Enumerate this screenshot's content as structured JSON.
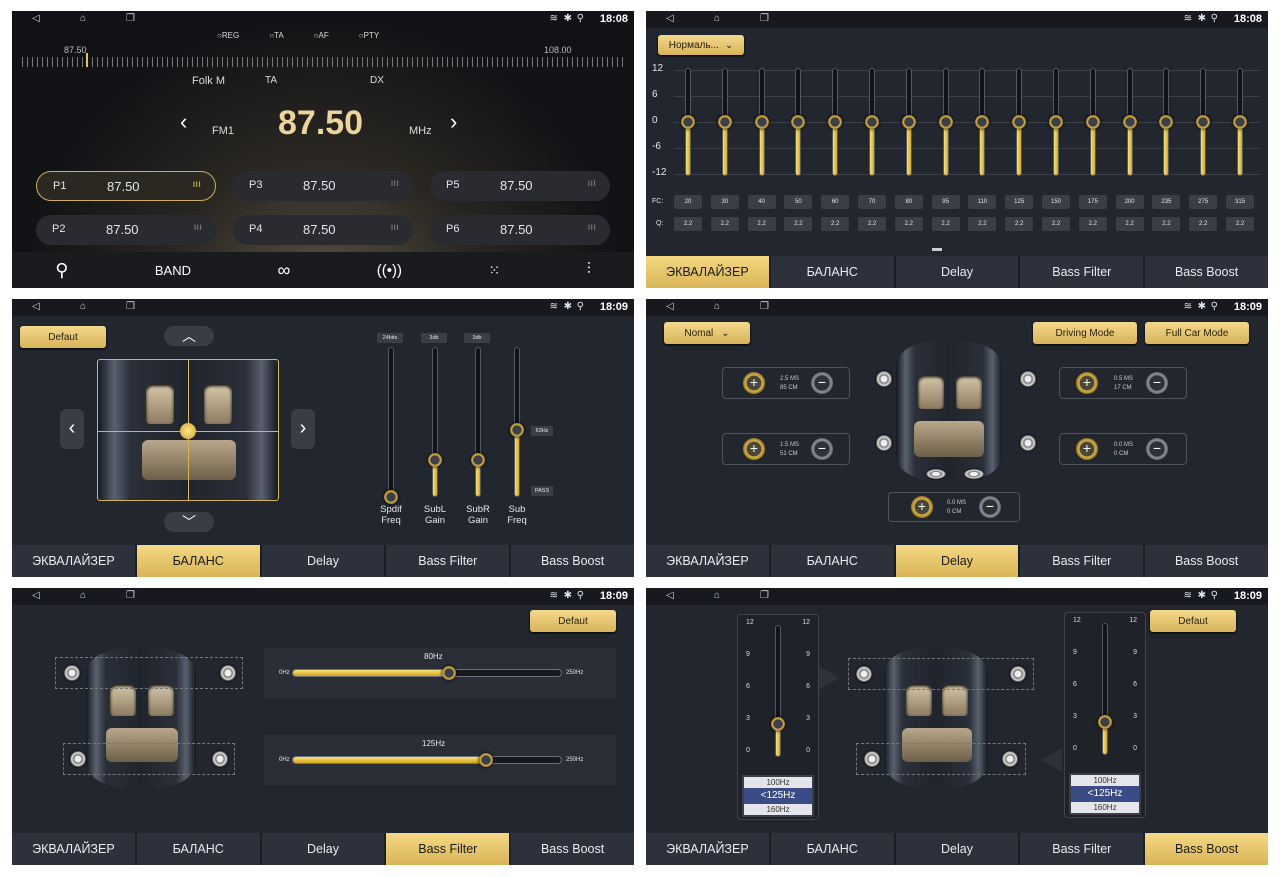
{
  "status": {
    "t1": "18:08",
    "t2": "18:08",
    "t3": "18:09",
    "t4": "18:09",
    "t5": "18:09",
    "t6": "18:09"
  },
  "nav_icons": {
    "back": "◁",
    "home": "⌂",
    "recent": "❐",
    "wifi": "wifi-icon",
    "bt": "bluetooth-icon",
    "gps": "location-icon"
  },
  "colors": {
    "accent": "#e5c25a",
    "bg": "#22262f",
    "tab": "#2c313b"
  },
  "tabs": [
    "ЭКВАЛАЙЗЕР",
    "БАЛАНС",
    "Delay",
    "Bass Filter",
    "Bass Boost"
  ],
  "radio": {
    "rds": [
      "REG",
      "TA",
      "AF",
      "PTY"
    ],
    "scale_min": "87.50",
    "scale_max": "108.00",
    "info": {
      "station": "Folk M",
      "ta": "TA",
      "dx": "DX"
    },
    "band": "FM1",
    "freq": "87.50",
    "unit": "MHz",
    "presets": [
      {
        "id": "P1",
        "freq": "87.50"
      },
      {
        "id": "P2",
        "freq": "87.50"
      },
      {
        "id": "P3",
        "freq": "87.50"
      },
      {
        "id": "P4",
        "freq": "87.50"
      },
      {
        "id": "P5",
        "freq": "87.50"
      },
      {
        "id": "P6",
        "freq": "87.50"
      }
    ],
    "bottom": {
      "band": "BAND"
    }
  },
  "eq": {
    "preset": "Нормаль...",
    "scale": [
      "12",
      "6",
      "0",
      "-6",
      "-12"
    ],
    "fc_label": "FC:",
    "q_label": "Q:",
    "fc": [
      "20",
      "30",
      "40",
      "50",
      "60",
      "70",
      "80",
      "95",
      "110",
      "125",
      "150",
      "175",
      "200",
      "235",
      "275",
      "315"
    ],
    "q": [
      "2.2",
      "2.2",
      "2.2",
      "2.2",
      "2.2",
      "2.2",
      "2.2",
      "2.2",
      "2.2",
      "2.2",
      "2.2",
      "2.2",
      "2.2",
      "2.2",
      "2.2",
      "2.2"
    ],
    "gains": [
      0,
      0,
      0,
      0,
      0,
      0,
      0,
      0,
      0,
      0,
      0,
      0,
      0,
      0,
      0,
      0
    ]
  },
  "balance": {
    "default": "Defaut",
    "sliders": [
      {
        "top": "24bits",
        "name1": "Spdif",
        "name2": "Freq",
        "level": 0
      },
      {
        "top": "3db",
        "name1": "SubL",
        "name2": "Gain",
        "level": 0.25
      },
      {
        "top": "3db",
        "name1": "SubR",
        "name2": "Gain",
        "level": 0.25
      },
      {
        "top": "63Hz",
        "name1": "Sub",
        "name2": "Freq",
        "level": 0.45,
        "bottom": "PASS"
      }
    ]
  },
  "delay": {
    "preset": "Nomal",
    "driving": "Driving Mode",
    "fullcar": "Full Car Mode",
    "boxes": [
      {
        "ms": "2.5 MS",
        "cm": "85 CM"
      },
      {
        "ms": "0.5 MS",
        "cm": "17 CM"
      },
      {
        "ms": "1.5 MS",
        "cm": "51 CM"
      },
      {
        "ms": "0.0 MS",
        "cm": "0 CM"
      },
      {
        "ms": "0.0 MS",
        "cm": "0 CM"
      }
    ]
  },
  "bassfilter": {
    "default": "Defaut",
    "f1": {
      "value": "80Hz",
      "min": "0Hz",
      "max": "250Hz",
      "level": 0.58
    },
    "f2": {
      "value": "125Hz",
      "min": "0Hz",
      "max": "250Hz",
      "level": 0.72
    }
  },
  "bassboost": {
    "default": "Defaut",
    "scale": [
      "12",
      "9",
      "6",
      "3",
      "0"
    ],
    "left": {
      "options": [
        "100Hz",
        "<125Hz",
        "160Hz"
      ],
      "level": 0.25
    },
    "right": {
      "options": [
        "100Hz",
        "<125Hz",
        "160Hz"
      ],
      "level": 0.25
    }
  }
}
